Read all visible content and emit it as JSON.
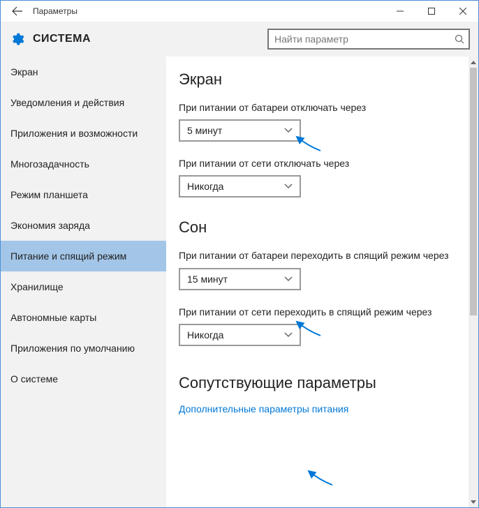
{
  "window": {
    "title": "Параметры"
  },
  "header": {
    "section_title": "СИСТЕМА",
    "search_placeholder": "Найти параметр"
  },
  "sidebar": {
    "items": [
      {
        "label": "Экран"
      },
      {
        "label": "Уведомления и действия"
      },
      {
        "label": "Приложения и возможности"
      },
      {
        "label": "Многозадачность"
      },
      {
        "label": "Режим планшета"
      },
      {
        "label": "Экономия заряда"
      },
      {
        "label": "Питание и спящий режим",
        "active": true
      },
      {
        "label": "Хранилище"
      },
      {
        "label": "Автономные карты"
      },
      {
        "label": "Приложения по умолчанию"
      },
      {
        "label": "О системе"
      }
    ]
  },
  "content": {
    "screen": {
      "title": "Экран",
      "battery_label": "При питании от батареи отключать через",
      "battery_value": "5 минут",
      "ac_label": "При питании от сети отключать через",
      "ac_value": "Никогда"
    },
    "sleep": {
      "title": "Сон",
      "battery_label": "При питании от батареи переходить в спящий режим через",
      "battery_value": "15 минут",
      "ac_label": "При питании от сети переходить в спящий режим через",
      "ac_value": "Никогда"
    },
    "related": {
      "title": "Сопутствующие параметры",
      "link": "Дополнительные параметры питания"
    }
  }
}
